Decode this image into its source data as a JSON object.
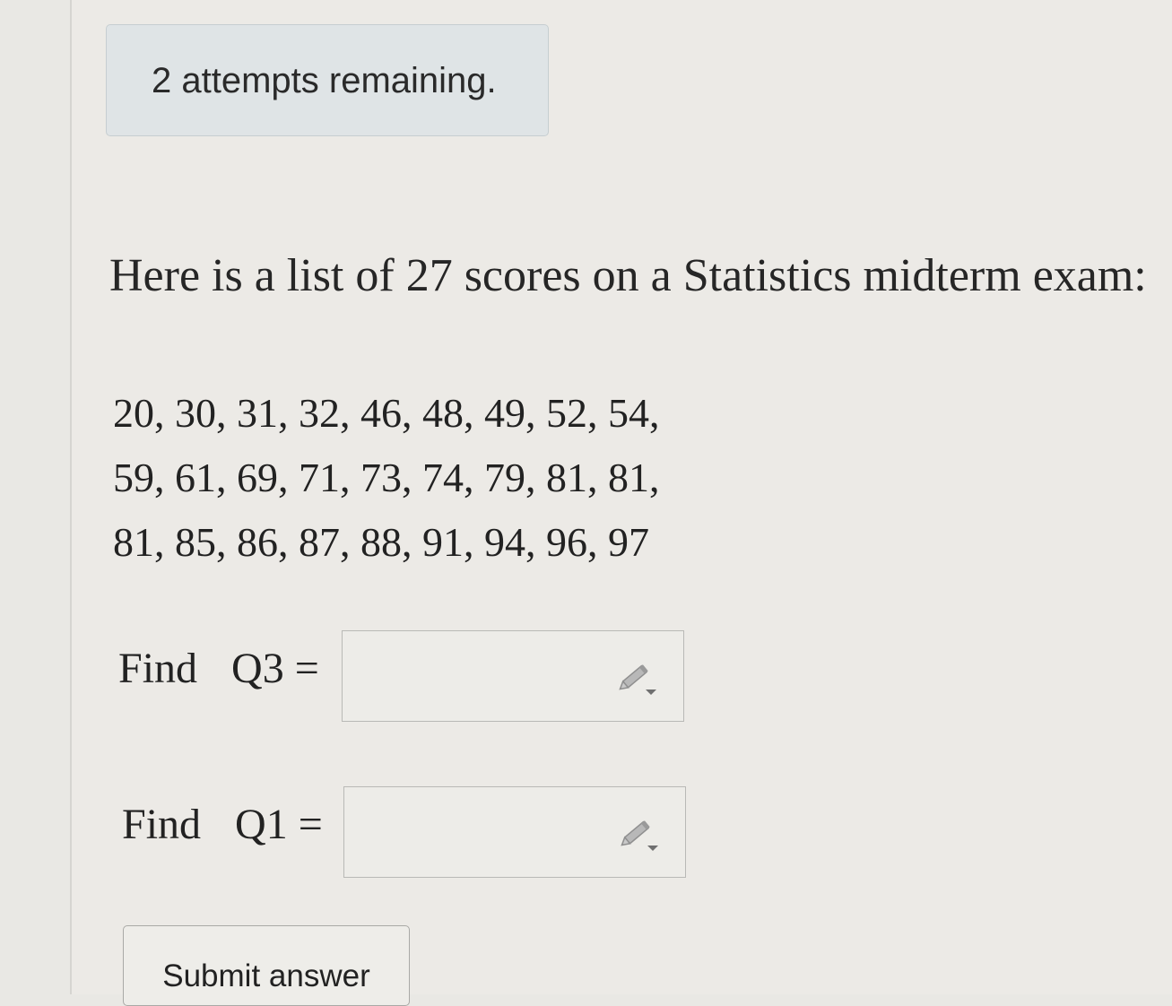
{
  "status": {
    "attempts": "2 attempts remaining."
  },
  "question": {
    "prompt": "Here is a list of 27 scores on a Statistics midterm exam:",
    "scores_lines": [
      "20, 30, 31, 32, 46, 48, 49, 52, 54,",
      "59, 61, 69, 71, 73, 74, 79, 81, 81,",
      "81, 85, 86, 87, 88, 91, 94, 96, 97"
    ]
  },
  "q3": {
    "find": "Find",
    "label": "Q3 =",
    "value": ""
  },
  "q1": {
    "find": "Find",
    "label": "Q1 =",
    "value": ""
  },
  "submit": {
    "label": "Submit answer"
  },
  "icons": {
    "answer_tool": "pencil-dropdown-icon"
  },
  "colors": {
    "notice_bg": "#dfe4e6",
    "page_bg": "#eceae6",
    "text": "#222222"
  }
}
